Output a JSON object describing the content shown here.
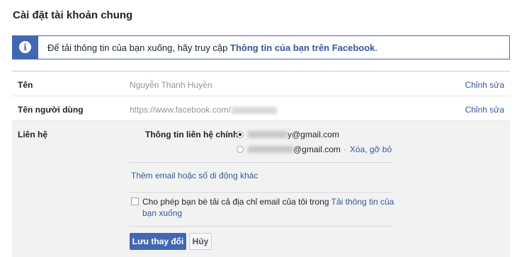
{
  "page_title": "Cài đặt tài khoản chung",
  "info": {
    "text": "Để tải thông tin của bạn xuống, hãy truy cập ",
    "link": "Thông tin của bạn trên Facebook",
    "suffix": "."
  },
  "rows": {
    "name": {
      "label": "Tên",
      "value": "Nguyễn Thanh Huyền",
      "edit": "Chỉnh sửa"
    },
    "username": {
      "label": "Tên người dùng",
      "value": "https://www.facebook.com/",
      "edit": "Chỉnh sửa"
    },
    "contact": {
      "label": "Liên hệ",
      "primary_label": "Thông tin liên hệ chính",
      "emails": [
        {
          "value": "y@gmail.com",
          "selected": true
        },
        {
          "value": "@gmail.com",
          "selected": false,
          "sep": "·",
          "remove": "Xóa, gỡ bỏ"
        }
      ],
      "add_link": "Thêm email hoặc số di động khác",
      "allow_text": "Cho phép bạn bè tải cả địa chỉ email của tôi trong ",
      "allow_link": "Tải thông tin của bạn xuống",
      "save_label": "Lưu thay đổi",
      "cancel_label": "Hủy"
    }
  },
  "colors": {
    "accent": "#4267b2",
    "link": "#365899",
    "muted": "#90949c",
    "panel": "#f2f2f2"
  }
}
